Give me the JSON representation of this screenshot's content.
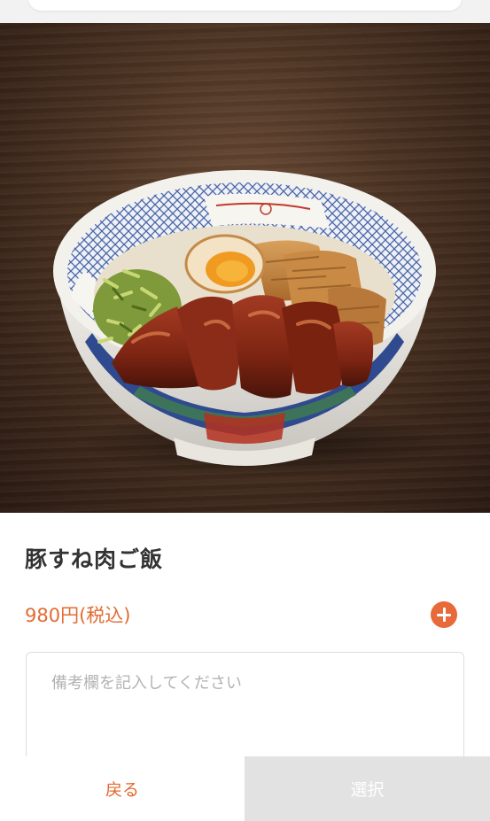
{
  "item": {
    "name": "豚すね肉ご飯",
    "price": "980円(税込)",
    "photo_subject": "bowl-of-braised-pork-shank-rice"
  },
  "memo": {
    "placeholder": "備考欄を記入してください",
    "value": ""
  },
  "actions": {
    "back_label": "戻る",
    "select_label": "選択",
    "select_enabled": false
  },
  "icons": {
    "add": "plus-circle-icon"
  },
  "colors": {
    "accent": "#e8693a",
    "price": "#e36b33",
    "title": "#333333",
    "disabled_button": "#e2e2e2"
  }
}
